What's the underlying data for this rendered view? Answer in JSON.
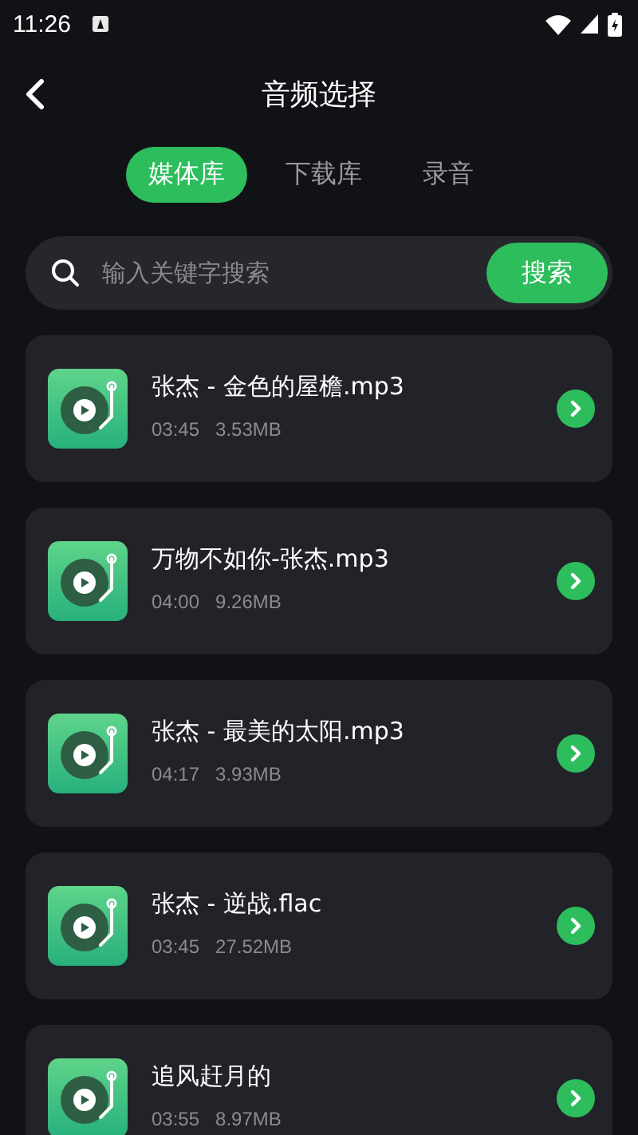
{
  "status_bar": {
    "time": "11:26"
  },
  "header": {
    "title": "音频选择"
  },
  "tabs": [
    {
      "label": "媒体库",
      "selected": true
    },
    {
      "label": "下载库",
      "selected": false
    },
    {
      "label": "录音",
      "selected": false
    }
  ],
  "search": {
    "placeholder": "输入关键字搜索",
    "button": "搜索"
  },
  "files": [
    {
      "name": "张杰 - 金色的屋檐.mp3",
      "duration": "03:45",
      "size": "3.53MB"
    },
    {
      "name": "万物不如你-张杰.mp3",
      "duration": "04:00",
      "size": "9.26MB"
    },
    {
      "name": "张杰 - 最美的太阳.mp3",
      "duration": "04:17",
      "size": "3.93MB"
    },
    {
      "name": "张杰 - 逆战.flac",
      "duration": "03:45",
      "size": "27.52MB"
    },
    {
      "name": "追风赶月的",
      "duration": "03:55",
      "size": "8.97MB"
    }
  ]
}
